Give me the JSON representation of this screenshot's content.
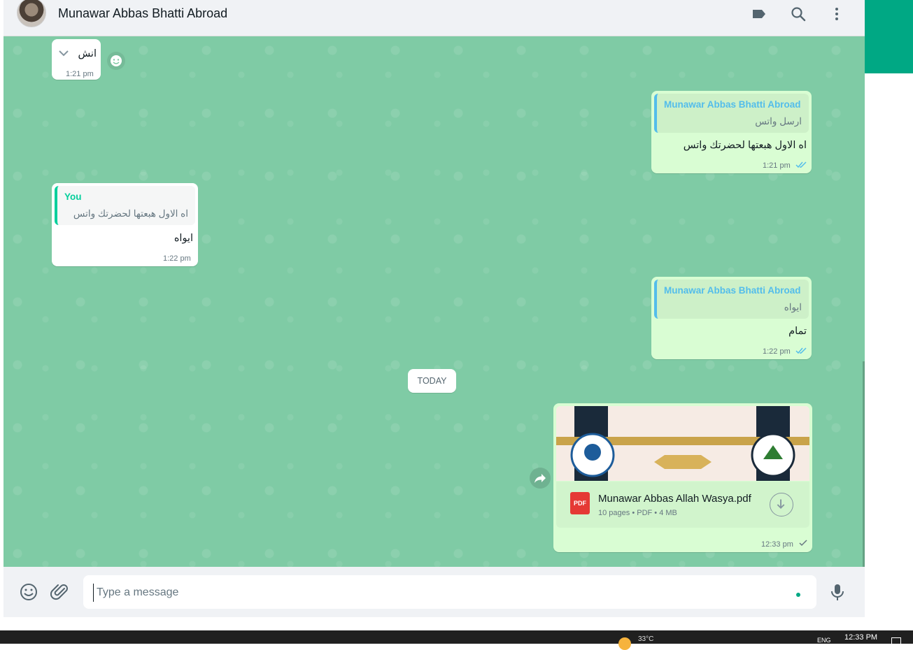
{
  "header": {
    "contact_name": "Munawar Abbas Bhatti Abroad",
    "icons": [
      "label-icon",
      "search-icon",
      "menu-icon"
    ]
  },
  "messages": {
    "m1": {
      "text": "انش",
      "time": "1:21 pm"
    },
    "m2": {
      "quote_author": "Munawar Abbas Bhatti Abroad",
      "quote_text": "ارسل واتس",
      "text": "اه الاول هبعتها لحضرتك واتس",
      "time": "1:21 pm"
    },
    "m3": {
      "quote_author": "You",
      "quote_text": "اه الاول هبعتها لحضرتك واتس",
      "text": "ايواه",
      "time": "1:22 pm"
    },
    "m4": {
      "quote_author": "Munawar Abbas Bhatti Abroad",
      "quote_text": "ايواه",
      "text": "تمام",
      "time": "1:22 pm"
    },
    "date_divider": "TODAY",
    "m5": {
      "file_type": "PDF",
      "file_name": "Munawar Abbas Allah Wasya.pdf",
      "file_meta": "10 pages • PDF • 4 MB",
      "time": "12:33 pm"
    }
  },
  "composer": {
    "placeholder": "Type a message",
    "icons": [
      "emoji-icon",
      "attach-icon",
      "mic-icon"
    ]
  },
  "taskbar": {
    "weather": "33°C",
    "lang": "ENG",
    "time": "12:33 PM"
  },
  "colors": {
    "accent": "#00a884",
    "chat_background": "#7fcba5",
    "outgoing_bubble": "#d9fdd3",
    "incoming_bubble": "#ffffff",
    "quote_author": "#53bdeb",
    "you_author": "#06cf9c",
    "read_ticks": "#53bdeb"
  }
}
